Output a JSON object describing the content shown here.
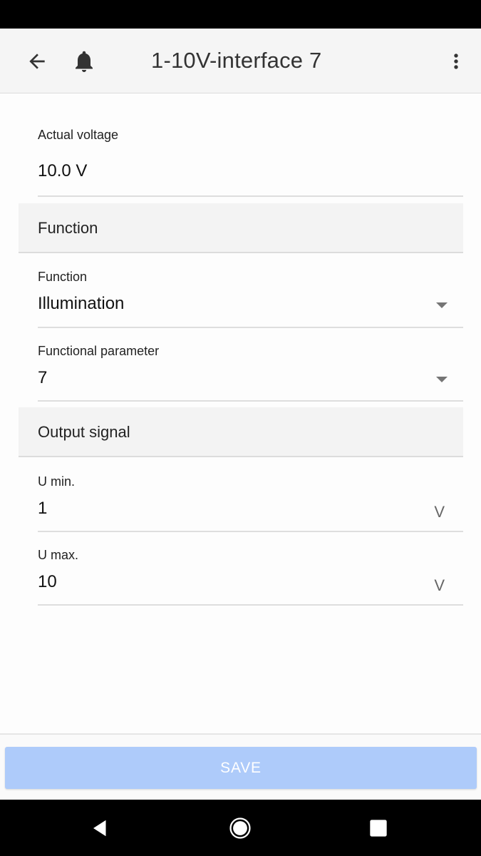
{
  "header": {
    "title": "1-10V-interface 7",
    "icons": {
      "back": "arrow-back-icon",
      "notifications": "bell-icon",
      "menu": "more-vert-icon"
    }
  },
  "actual_voltage": {
    "label": "Actual voltage",
    "value": "10.0 V"
  },
  "sections": {
    "function": "Function",
    "output_signal": "Output signal"
  },
  "fields": {
    "function": {
      "label": "Function",
      "value": "Illumination"
    },
    "functional_parameter": {
      "label": "Functional parameter",
      "value": "7"
    },
    "u_min": {
      "label": "U min.",
      "value": "1",
      "unit": "V"
    },
    "u_max": {
      "label": "U max.",
      "value": "10",
      "unit": "V"
    }
  },
  "footer": {
    "save_label": "SAVE"
  },
  "colors": {
    "save_button": "#aecbfa",
    "app_bar": "#f5f5f5",
    "section_bg": "#f3f3f3"
  }
}
